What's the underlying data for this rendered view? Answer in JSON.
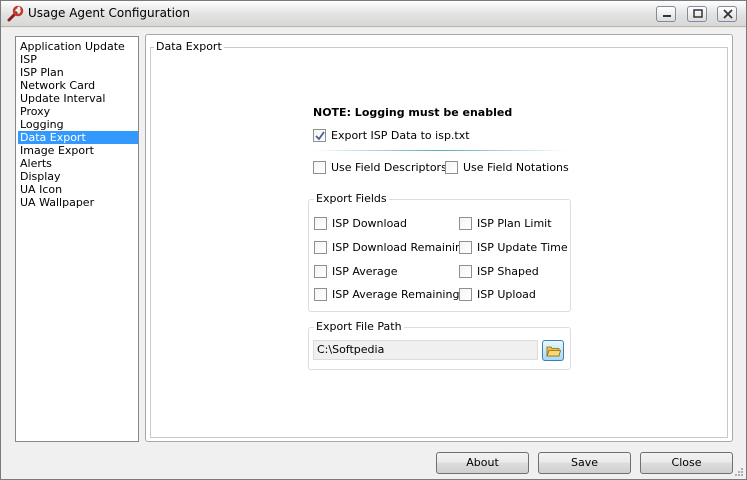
{
  "window": {
    "title": "Usage Agent Configuration",
    "buttons": {
      "minimize": "minimize-icon",
      "maximize": "maximize-icon",
      "close": "close-icon"
    }
  },
  "nav": {
    "items": [
      {
        "label": "Application Update"
      },
      {
        "label": "ISP"
      },
      {
        "label": "ISP Plan"
      },
      {
        "label": "Network Card"
      },
      {
        "label": "Update Interval"
      },
      {
        "label": "Proxy"
      },
      {
        "label": "Logging"
      },
      {
        "label": "Data Export",
        "selected": true
      },
      {
        "label": "Image Export"
      },
      {
        "label": "Alerts"
      },
      {
        "label": "Display"
      },
      {
        "label": "UA Icon"
      },
      {
        "label": "UA Wallpaper"
      }
    ]
  },
  "panel": {
    "title": "Data Export",
    "note": "NOTE: Logging must be enabled",
    "export_isp": {
      "label": "Export ISP Data to isp.txt",
      "checked": true
    },
    "use_descriptors": {
      "label": "Use Field Descriptors",
      "checked": false
    },
    "use_notations": {
      "label": "Use Field Notations",
      "checked": false
    },
    "fields": {
      "title": "Export Fields",
      "left": [
        {
          "label": "ISP Download",
          "checked": false
        },
        {
          "label": "ISP Download Remaining",
          "checked": false
        },
        {
          "label": "ISP Average",
          "checked": false
        },
        {
          "label": "ISP Average Remaining",
          "checked": false
        }
      ],
      "right": [
        {
          "label": "ISP Plan Limit",
          "checked": false
        },
        {
          "label": "ISP Update Time",
          "checked": false
        },
        {
          "label": "ISP Shaped",
          "checked": false
        },
        {
          "label": "ISP Upload",
          "checked": false
        }
      ]
    },
    "path": {
      "title": "Export File Path",
      "value": "C:\\Softpedia",
      "browse_icon": "folder-icon"
    }
  },
  "buttons": {
    "about": "About",
    "save": "Save",
    "close": "Close"
  },
  "colors": {
    "selection": "#3399ff",
    "accent": "#5aa7c4"
  }
}
